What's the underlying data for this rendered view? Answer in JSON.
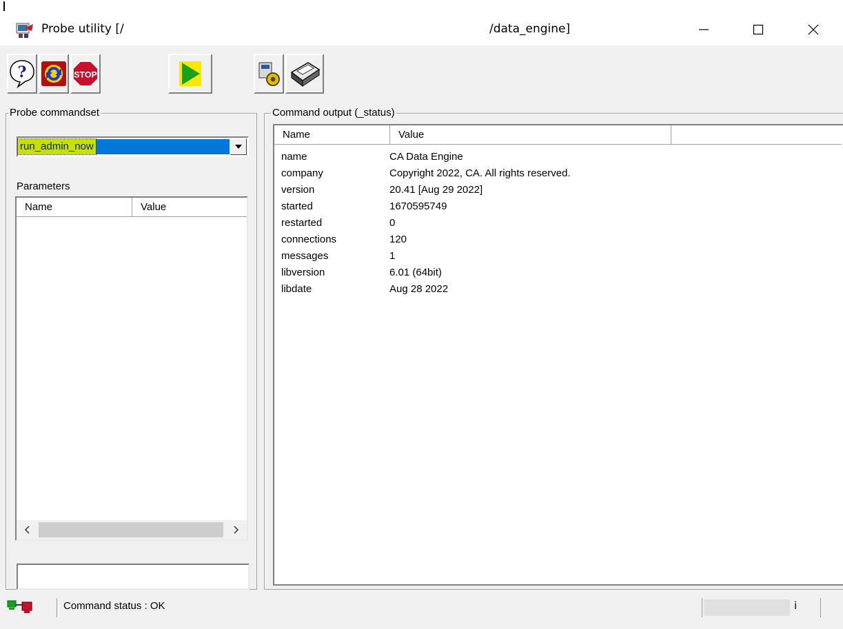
{
  "window": {
    "title_left": "Probe utility [/",
    "title_right": "/data_engine]",
    "controls": {
      "minimize": "—",
      "maximize": "☐",
      "close": "✕"
    }
  },
  "toolbar": {
    "buttons": [
      {
        "name": "help",
        "icon": "help-question-icon",
        "label": "?"
      },
      {
        "name": "refresh",
        "icon": "refresh-icon"
      },
      {
        "name": "stop",
        "icon": "stop-sign-icon",
        "label": "STOP"
      },
      {
        "name": "run",
        "icon": "play-icon"
      },
      {
        "name": "settings",
        "icon": "gear-settings-icon"
      },
      {
        "name": "print",
        "icon": "printer-icon"
      }
    ]
  },
  "commandset": {
    "group_label": "Probe commandset",
    "selected": "run_admin_now",
    "parameters_label": "Parameters",
    "columns": [
      "Name",
      "Value"
    ],
    "input_value": ""
  },
  "output": {
    "group_label": "Command output (_status)",
    "columns": [
      "Name",
      "Value"
    ],
    "rows": [
      {
        "name": "name",
        "value": "CA Data Engine"
      },
      {
        "name": "company",
        "value": "Copyright 2022, CA. All rights reserved."
      },
      {
        "name": "version",
        "value": "20.41 [Aug 29 2022]"
      },
      {
        "name": "started",
        "value": "1670595749"
      },
      {
        "name": "restarted",
        "value": "0"
      },
      {
        "name": "connections",
        "value": "120"
      },
      {
        "name": "messages",
        "value": "1"
      },
      {
        "name": "libversion",
        "value": "6.01 (64bit)"
      },
      {
        "name": "libdate",
        "value": "Aug 28 2022"
      }
    ]
  },
  "status": {
    "text": "Command status : OK",
    "progress_text": "i"
  },
  "colors": {
    "selection": "#0078d7",
    "highlight": "#c8e000",
    "stop_red": "#c8102e"
  }
}
